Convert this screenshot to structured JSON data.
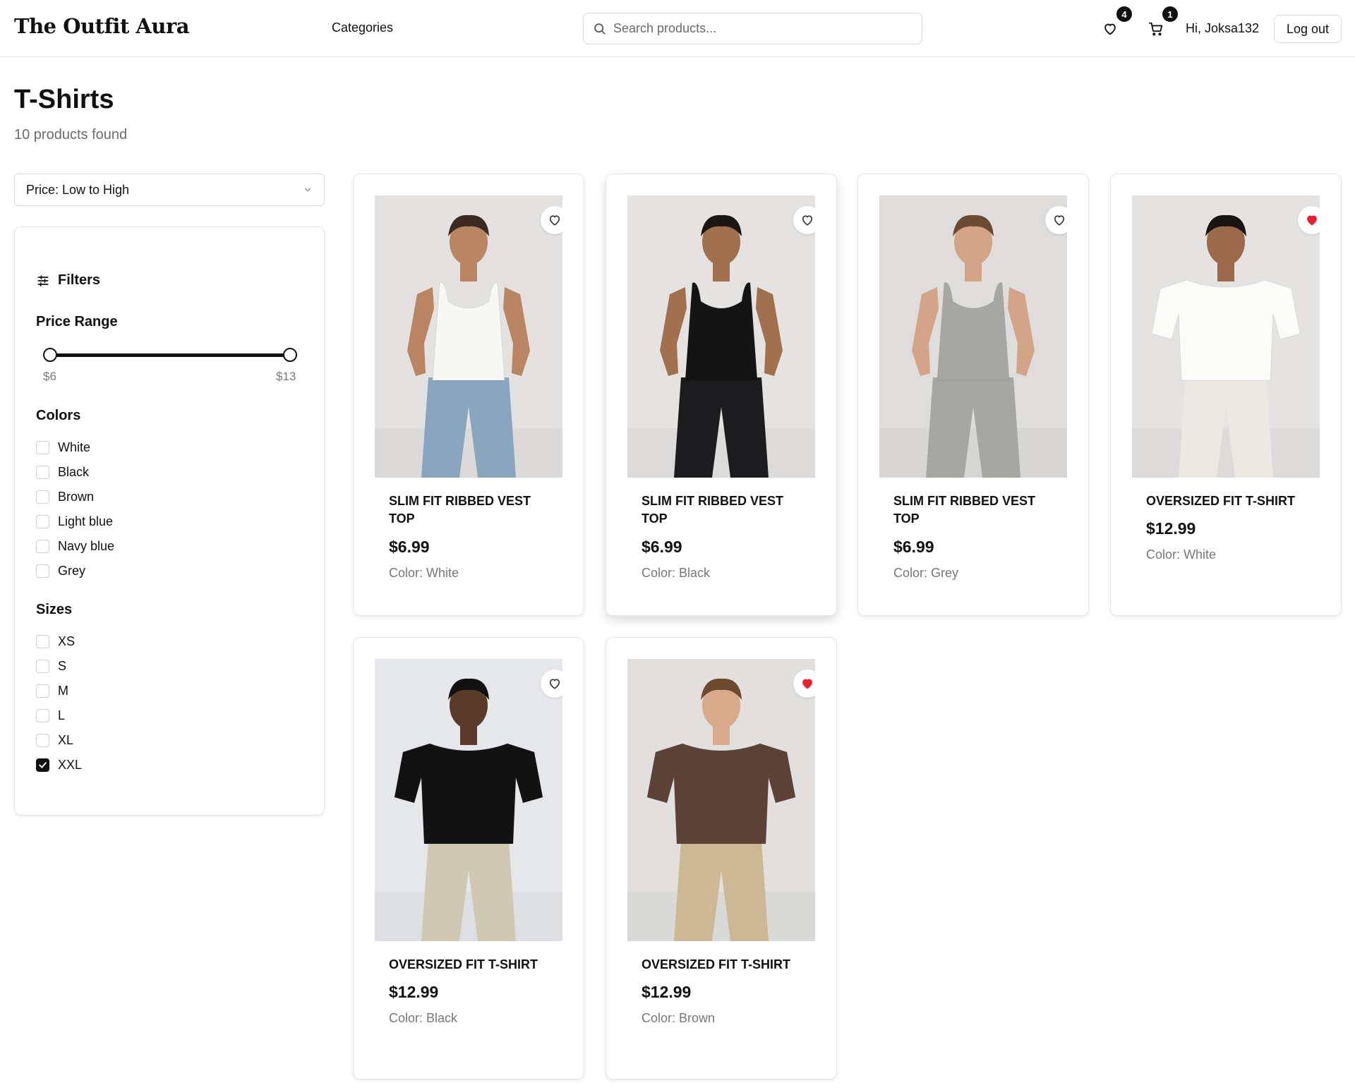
{
  "header": {
    "logo": "The Outfit Aura",
    "nav_categories": "Categories",
    "search_placeholder": "Search products...",
    "wishlist_count": "4",
    "cart_count": "1",
    "greeting": "Hi, Joksa132",
    "logout_label": "Log out"
  },
  "page": {
    "title": "T-Shirts",
    "count_text": "10 products found"
  },
  "sort": {
    "selected": "Price: Low to High"
  },
  "filters": {
    "title": "Filters",
    "price_range": {
      "label": "Price Range",
      "min_label": "$6",
      "max_label": "$13",
      "low": 6,
      "high": 13
    },
    "colors": {
      "title": "Colors",
      "options": [
        {
          "label": "White",
          "checked": false
        },
        {
          "label": "Black",
          "checked": false
        },
        {
          "label": "Brown",
          "checked": false
        },
        {
          "label": "Light blue",
          "checked": false
        },
        {
          "label": "Navy blue",
          "checked": false
        },
        {
          "label": "Grey",
          "checked": false
        }
      ]
    },
    "sizes": {
      "title": "Sizes",
      "options": [
        {
          "label": "XS",
          "checked": false
        },
        {
          "label": "S",
          "checked": false
        },
        {
          "label": "M",
          "checked": false
        },
        {
          "label": "L",
          "checked": false
        },
        {
          "label": "XL",
          "checked": false
        },
        {
          "label": "XXL",
          "checked": true
        }
      ]
    }
  },
  "products": [
    {
      "name": "SLIM FIT RIBBED VEST TOP",
      "price": "$6.99",
      "color_text": "Color: White",
      "favorited": false,
      "top_color": "#f7f7f5",
      "bottom_color": "#8aa6bf",
      "bg_color": "#e3e2e0",
      "skin": "#b98563",
      "hair": "#3a2a22"
    },
    {
      "name": "SLIM FIT RIBBED VEST TOP",
      "price": "$6.99",
      "color_text": "Color: Black",
      "favorited": false,
      "top_color": "#141414",
      "bottom_color": "#1c1c1e",
      "bg_color": "#e4e3e1",
      "skin": "#a0704f",
      "hair": "#1b1613"
    },
    {
      "name": "SLIM FIT RIBBED VEST TOP",
      "price": "$6.99",
      "color_text": "Color: Grey",
      "favorited": false,
      "top_color": "#a6a6a3",
      "bottom_color": "#a6a6a3",
      "bg_color": "#dedddb",
      "skin": "#d3a487",
      "hair": "#6b4a32"
    },
    {
      "name": "OVERSIZED FIT T-SHIRT",
      "price": "$12.99",
      "color_text": "Color: White",
      "favorited": true,
      "top_color": "#fbfbfa",
      "bottom_color": "#ebe9e2",
      "bg_color": "#e4e3e1",
      "skin": "#9a6a4a",
      "hair": "#1a1512"
    },
    {
      "name": "OVERSIZED FIT T-SHIRT",
      "price": "$12.99",
      "color_text": "Color: Black",
      "favorited": false,
      "top_color": "#121212",
      "bottom_color": "#cfc8b2",
      "bg_color": "#e6e7ea",
      "skin": "#5a3a28",
      "hair": "#111111"
    },
    {
      "name": "OVERSIZED FIT T-SHIRT",
      "price": "$12.99",
      "color_text": "Color: Brown",
      "favorited": true,
      "top_color": "#5b4136",
      "bottom_color": "#cdb896",
      "bg_color": "#e1e0de",
      "skin": "#d9a98b",
      "hair": "#6b4a2e"
    }
  ],
  "colors": {
    "accent": "#111111",
    "favorite_active": "#e8202f",
    "muted_text": "#777777"
  }
}
